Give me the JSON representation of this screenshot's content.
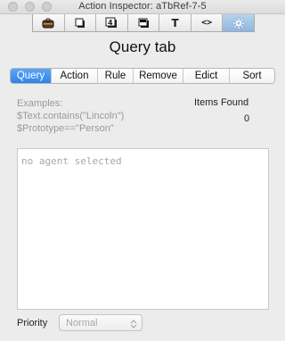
{
  "window": {
    "title": "Action Inspector: aTbRef-7-5"
  },
  "toolbar": {
    "icons": [
      "suitcase-icon",
      "document-icon",
      "four-icon",
      "shadow-square-icon",
      "text-t-icon",
      "code-brackets-icon",
      "gear-icon"
    ],
    "t_glyph": "T",
    "four_glyph": "4",
    "code_glyph": "<>",
    "active_index": 6
  },
  "page": {
    "title": "Query tab"
  },
  "tabs": {
    "items": [
      "Query",
      "Action",
      "Rule",
      "Remove",
      "Edict",
      "Sort"
    ],
    "active": "Query"
  },
  "examples": {
    "heading": "Examples:",
    "line1": "$Text.contains(\"Lincoln\")",
    "line2": "$Prototype==\"Person\""
  },
  "results": {
    "label": "Items Found",
    "count": "0"
  },
  "query_editor": {
    "placeholder": "no agent selected"
  },
  "priority": {
    "label": "Priority",
    "value": "Normal"
  },
  "colors": {
    "accent": "#2f83ea",
    "window_bg": "#ececec"
  }
}
